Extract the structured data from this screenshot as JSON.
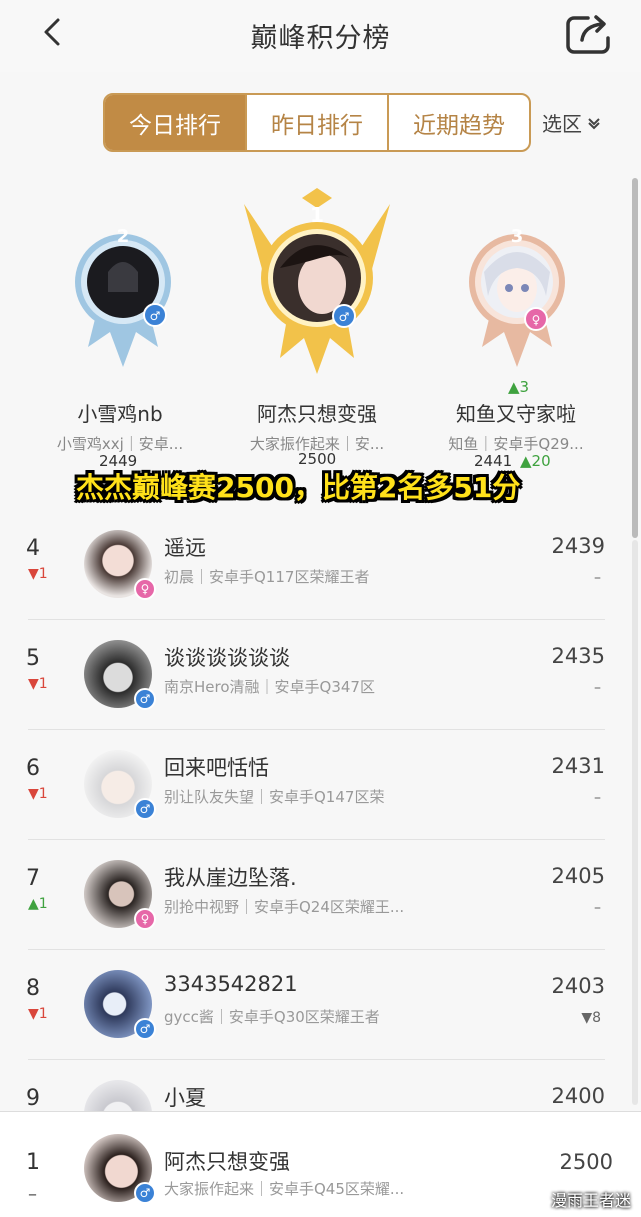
{
  "header": {
    "title": "巅峰积分榜",
    "back_icon": "chevron-left-icon",
    "share_icon": "share-icon"
  },
  "tabs": [
    {
      "label": "今日排行",
      "active": true
    },
    {
      "label": "昨日排行",
      "active": false
    },
    {
      "label": "近期趋势",
      "active": false
    }
  ],
  "region": {
    "label": "选区"
  },
  "podium": [
    {
      "place": "2",
      "name": "小雪鸡nb",
      "sub": "小雪鸡xxj｜安卓...",
      "score": "2449",
      "change": "",
      "gender": "♂"
    },
    {
      "place": "1",
      "name": "阿杰只想变强",
      "sub": "大家振作起来｜安...",
      "score": "2500",
      "change": "",
      "gender": "♂"
    },
    {
      "place": "3",
      "name": "知鱼又守家啦",
      "sub": "知鱼｜安卓手Q29...",
      "score": "2441",
      "change": "▲20",
      "rank_change": "▲3",
      "gender": "♀"
    }
  ],
  "caption": "杰杰巅峰赛2500，比第2名多51分",
  "list": [
    {
      "rank": "4",
      "delta": "▼1",
      "dir": "down",
      "name": "遥远",
      "sub": "初晨｜安卓手Q117区荣耀王者",
      "score": "2439",
      "change": "–",
      "gender": "♀"
    },
    {
      "rank": "5",
      "delta": "▼1",
      "dir": "down",
      "name": "谈谈谈谈谈谈",
      "sub": "南京Hero清融｜安卓手Q347区",
      "score": "2435",
      "change": "–",
      "gender": "♂"
    },
    {
      "rank": "6",
      "delta": "▼1",
      "dir": "down",
      "name": "回来吧恬恬",
      "sub": "别让队友失望｜安卓手Q147区荣",
      "score": "2431",
      "change": "–",
      "gender": "♂"
    },
    {
      "rank": "7",
      "delta": "▲1",
      "dir": "up",
      "name": "我从崖边坠落.",
      "sub": "别抢中视野｜安卓手Q24区荣耀王...",
      "score": "2405",
      "change": "–",
      "gender": "♀"
    },
    {
      "rank": "8",
      "delta": "▼1",
      "dir": "down",
      "name": "3343542821",
      "sub": "gycc酱｜安卓手Q30区荣耀王者",
      "score": "2403",
      "change": "▼8",
      "gender": "♂"
    },
    {
      "rank": "9",
      "delta": "",
      "dir": "down",
      "name": "小夏",
      "sub": "",
      "score": "2400",
      "change": "",
      "gender": "♂"
    }
  ],
  "self": {
    "rank": "1",
    "dash": "–",
    "name": "阿杰只想变强",
    "sub": "大家振作起来｜安卓手Q45区荣耀...",
    "score": "2500",
    "gender": "♂"
  },
  "watermark": "漫雨王者迷",
  "colors": {
    "accent": "#c18b45",
    "down": "#d9463b",
    "up": "#3fa23f",
    "caption": "#ffe11a"
  }
}
